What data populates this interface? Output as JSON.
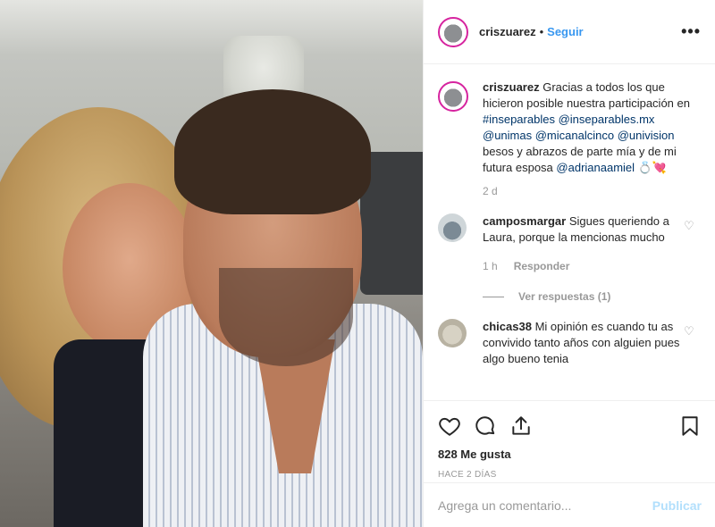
{
  "post": {
    "username": "criszuarez",
    "separator": "•",
    "follow_label": "Seguir",
    "more_label": "•••"
  },
  "caption": {
    "username": "criszuarez",
    "text_1": "Gracias a todos los que hicieron posible nuestra participación en",
    "tag_1": "#inseparables",
    "mention_1": "@inseparables.mx",
    "mention_2": "@unimas",
    "mention_3": "@micanalcinco",
    "mention_4": "@univision",
    "text_2": "besos y abrazos de parte mía y de mi futura esposa",
    "mention_5": "@adrianaamiel",
    "emoji": "💍💘",
    "time": "2 d"
  },
  "comments": [
    {
      "username": "camposmargar",
      "text": "Sigues queriendo a Laura, porque la mencionas mucho",
      "time": "1 h",
      "reply_label": "Responder",
      "view_replies": "Ver respuestas (1)"
    },
    {
      "username": "chicas38",
      "text": "Mi opinión es cuando tu as convivido tanto años con alguien pues algo bueno tenia"
    }
  ],
  "stats": {
    "likes": "828 Me gusta",
    "posted_ago": "HACE 2 DÍAS"
  },
  "composer": {
    "placeholder": "Agrega un comentario...",
    "publish_label": "Publicar"
  },
  "colors": {
    "accent": "#3897f0",
    "publish_disabled": "#b2dffc",
    "story_ring": "#d6249f"
  },
  "icons": [
    "heart-icon",
    "comment-icon",
    "share-icon",
    "bookmark-icon",
    "more-icon"
  ]
}
